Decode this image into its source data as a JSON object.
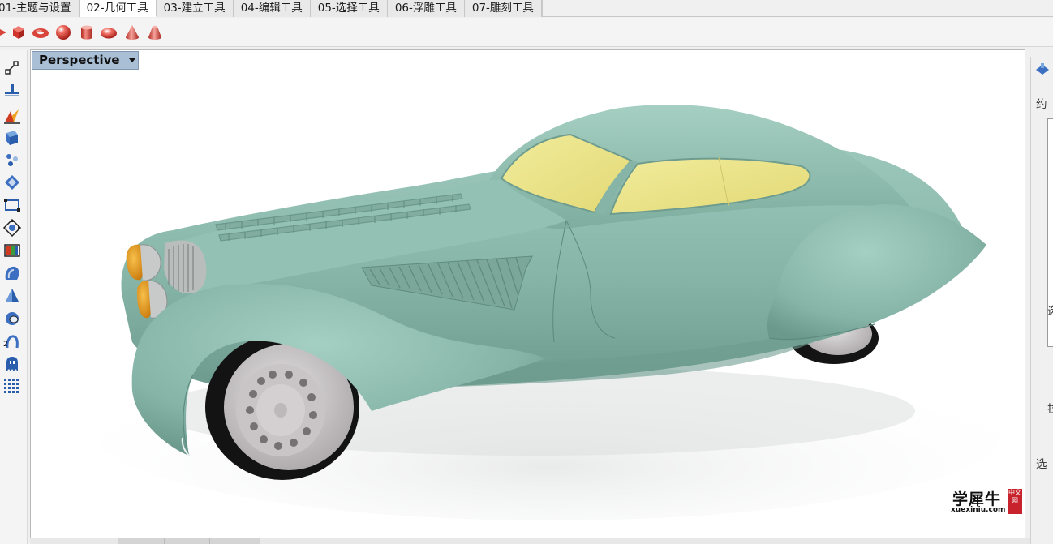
{
  "tabs": [
    {
      "label": "01-主题与设置",
      "active": false
    },
    {
      "label": "02-几何工具",
      "active": true
    },
    {
      "label": "03-建立工具",
      "active": false
    },
    {
      "label": "04-编辑工具",
      "active": false
    },
    {
      "label": "05-选择工具",
      "active": false
    },
    {
      "label": "06-浮雕工具",
      "active": false
    },
    {
      "label": "07-雕刻工具",
      "active": false
    }
  ],
  "toolbar_icons": [
    "arrow-icon",
    "box-icon",
    "torus-icon",
    "sphere-icon",
    "cylinder-icon",
    "ellipsoid-icon",
    "cone-icon",
    "truncated-cone-icon"
  ],
  "left_tools": [
    "point-grid-icon",
    "dimension-icon",
    "explode-icon",
    "cube-face-icon",
    "scatter-icon",
    "move-icon",
    "rectangle-icon",
    "gumball-icon",
    "color-bar-icon",
    "shell-icon",
    "pyramid-icon",
    "sphere-cut-icon",
    "counter-icon",
    "ghost-icon",
    "dot-grid-icon"
  ],
  "left_tool_label": "2",
  "viewport": {
    "title": "Perspective"
  },
  "watermark": {
    "cn": "学犀牛",
    "en": "xuexiniu.com",
    "seal": "中文网"
  },
  "right_panel": {
    "labels": [
      "约",
      "选",
      "拉",
      "选"
    ]
  },
  "colors": {
    "body": "#86b5a8",
    "glass": "#eae48a",
    "headlight": "#e29a16",
    "tire": "#111111",
    "rim": "#d2cfd0",
    "viewport_title_bg": "#a9bfd6",
    "active_tab": "#ffffff"
  }
}
